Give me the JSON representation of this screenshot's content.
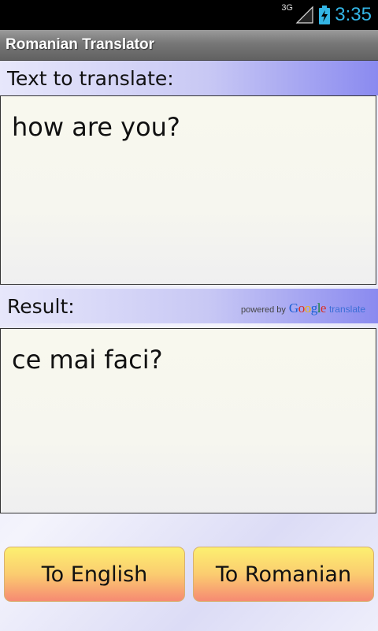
{
  "status_bar": {
    "network_type": "3G",
    "time": "3:35",
    "icons": [
      "signal-icon",
      "battery-charging-icon"
    ],
    "time_color": "#33b5e5"
  },
  "app": {
    "title": "Romanian Translator"
  },
  "input_section": {
    "label": "Text to translate:",
    "value": "how are you?"
  },
  "result_section": {
    "label": "Result:",
    "value": "ce mai faci?",
    "attribution": {
      "prefix": "powered by",
      "google": [
        "G",
        "o",
        "o",
        "g",
        "l",
        "e"
      ],
      "google_colors": [
        "#1a5fd4",
        "#d93025",
        "#f4b400",
        "#1a5fd4",
        "#188038",
        "#d93025"
      ],
      "suffix": "translate"
    }
  },
  "buttons": {
    "to_english": "To English",
    "to_romanian": "To Romanian"
  }
}
